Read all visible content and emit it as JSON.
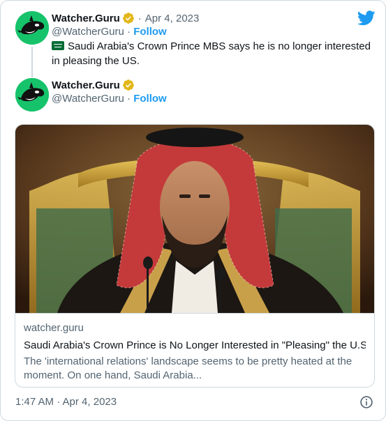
{
  "quoted_tweet": {
    "author_name": "Watcher.Guru",
    "handle": "@WatcherGuru",
    "separator": "·",
    "date": "Apr 4, 2023",
    "follow_label": "Follow",
    "text": "Saudi Arabia's Crown Prince MBS says he is no longer interested in pleasing the US."
  },
  "reply_tweet": {
    "author_name": "Watcher.Guru",
    "handle": "@WatcherGuru",
    "separator": "·",
    "follow_label": "Follow"
  },
  "link_card": {
    "domain": "watcher.guru",
    "title": "Saudi Arabia's Crown Prince is No Longer Interested in \"Pleasing\" the U.S.",
    "description": "The 'international relations' landscape seems to be pretty heated at the moment. On one hand, Saudi Arabia..."
  },
  "footer": {
    "timestamp": "1:47 AM · Apr 4, 2023"
  },
  "colors": {
    "accent": "#1d9bf0",
    "verified": "#e2b719",
    "avatar_bg": "#16c36b",
    "text_secondary": "#536471",
    "flag": "#006c35"
  },
  "icons": {
    "brand": "twitter-bird-icon",
    "verified": "verified-badge-icon",
    "flag": "saudi-arabia-flag-icon",
    "info": "info-circle-icon"
  }
}
